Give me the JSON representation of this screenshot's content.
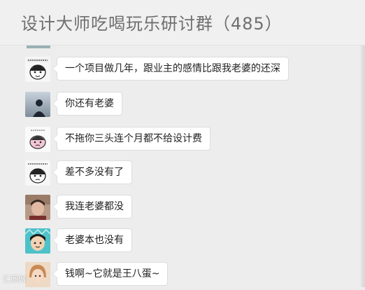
{
  "header": {
    "title": "设计大师吃喝玩乐研讨群（485）"
  },
  "messages": [
    {
      "text": "一个项目做几年，跟业主的感情比跟我老婆的还深",
      "avatar": "cartoon-face-with-caption-avatar"
    },
    {
      "text": "你还有老婆",
      "avatar": "silhouette-person-avatar"
    },
    {
      "text": "不拖你三头连个月都不给设计费",
      "avatar": "cartoon-face-pink-avatar"
    },
    {
      "text": "差不多没有了",
      "avatar": "cartoon-face-with-caption-avatar"
    },
    {
      "text": "我连老婆都没",
      "avatar": "photo-person-avatar"
    },
    {
      "text": "老婆本也没有",
      "avatar": "cartoon-boy-avatar"
    },
    {
      "text": "钱啊~它就是王八蛋~",
      "avatar": "photo-girl-avatar"
    }
  ],
  "watermark": "汇图网"
}
